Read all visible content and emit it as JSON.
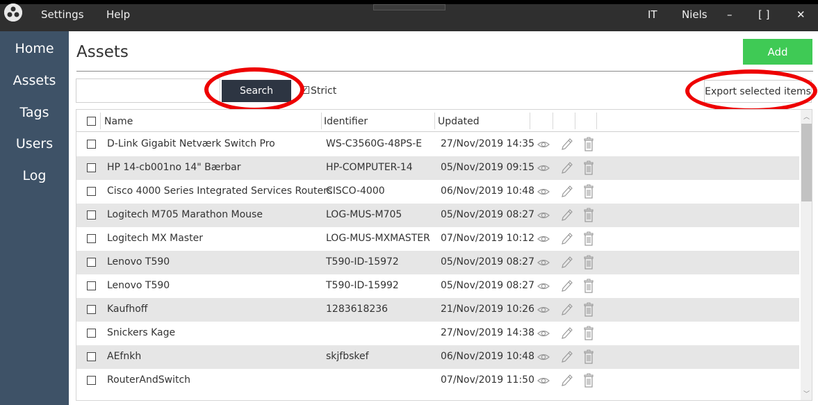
{
  "menu": {
    "settings": "Settings",
    "help": "Help"
  },
  "window": {
    "department": "IT",
    "user": "Niels",
    "minimize": "–",
    "maximize": "[ ]",
    "close": "✕"
  },
  "sidebar": {
    "items": [
      {
        "label": "Home"
      },
      {
        "label": "Assets"
      },
      {
        "label": "Tags"
      },
      {
        "label": "Users"
      },
      {
        "label": "Log"
      }
    ]
  },
  "page": {
    "title": "Assets",
    "add_label": "Add"
  },
  "search": {
    "value": "",
    "button_label": "Search",
    "strict_label": "Strict",
    "strict_checked": true
  },
  "export": {
    "label": "Export selected items"
  },
  "table": {
    "columns": {
      "name": "Name",
      "identifier": "Identifier",
      "updated": "Updated"
    },
    "rows": [
      {
        "name": "D-Link Gigabit Netværk Switch Pro",
        "identifier": "WS-C3560G-48PS-E",
        "updated": "27/Nov/2019 14:35"
      },
      {
        "name": "HP 14-cb001no 14\" Bærbar",
        "identifier": "HP-COMPUTER-14",
        "updated": "05/Nov/2019 09:15"
      },
      {
        "name": "Cisco 4000 Series Integrated Services Routers",
        "identifier": "CISCO-4000",
        "updated": "06/Nov/2019 10:48"
      },
      {
        "name": "Logitech M705 Marathon Mouse",
        "identifier": "LOG-MUS-M705",
        "updated": "05/Nov/2019 08:27"
      },
      {
        "name": "Logitech MX Master",
        "identifier": "LOG-MUS-MXMASTER",
        "updated": "07/Nov/2019 10:12"
      },
      {
        "name": "Lenovo T590",
        "identifier": "T590-ID-15972",
        "updated": "05/Nov/2019 08:27"
      },
      {
        "name": "Lenovo T590",
        "identifier": "T590-ID-15992",
        "updated": "05/Nov/2019 08:27"
      },
      {
        "name": "Kaufhoff",
        "identifier": "1283618236",
        "updated": "21/Nov/2019 10:26"
      },
      {
        "name": "Snickers Kage",
        "identifier": "",
        "updated": "27/Nov/2019 14:38"
      },
      {
        "name": "AEfnkh",
        "identifier": "skjfbskef",
        "updated": "06/Nov/2019 10:48"
      },
      {
        "name": "RouterAndSwitch",
        "identifier": "",
        "updated": "07/Nov/2019 11:50"
      }
    ],
    "row_action_icons": [
      "eye-icon",
      "pencil-icon",
      "trash-icon"
    ]
  },
  "colors": {
    "topbar": "#2f2f2f",
    "sidebar": "#3e5267",
    "add_button": "#3fca55",
    "search_button": "#2d3542",
    "annotation": "#ee0000",
    "alt_row": "#e6e6e6"
  }
}
